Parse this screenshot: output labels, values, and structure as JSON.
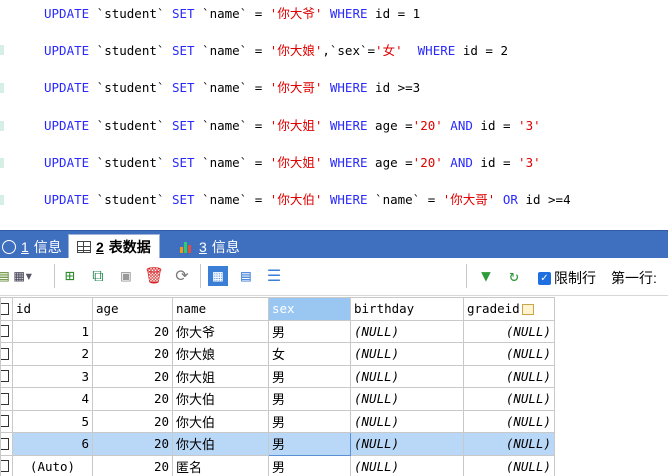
{
  "editor": {
    "lines": [
      [
        [
          "kw",
          "UPDATE"
        ],
        [
          "id",
          " `student` "
        ],
        [
          "kw",
          "SET"
        ],
        [
          "id",
          " `name` = "
        ],
        [
          "str",
          "'你大爷'"
        ],
        [
          "kw",
          " WHERE"
        ],
        [
          "id",
          " id = 1"
        ]
      ],
      [
        [
          "kw",
          "UPDATE"
        ],
        [
          "id",
          " `student` "
        ],
        [
          "kw",
          "SET"
        ],
        [
          "id",
          " `name` = "
        ],
        [
          "str",
          "'你大娘'"
        ],
        [
          "id",
          ",`sex`="
        ],
        [
          "str",
          "'女'"
        ],
        [
          "kw",
          "  WHERE"
        ],
        [
          "id",
          " id = 2"
        ]
      ],
      [
        [
          "kw",
          "UPDATE"
        ],
        [
          "id",
          " `student` "
        ],
        [
          "kw",
          "SET"
        ],
        [
          "id",
          " `name` = "
        ],
        [
          "str",
          "'你大哥'"
        ],
        [
          "kw",
          " WHERE"
        ],
        [
          "id",
          " id >=3"
        ]
      ],
      [
        [
          "kw",
          "UPDATE"
        ],
        [
          "id",
          " `student` "
        ],
        [
          "kw",
          "SET"
        ],
        [
          "id",
          " `name` = "
        ],
        [
          "str",
          "'你大姐'"
        ],
        [
          "kw",
          " WHERE"
        ],
        [
          "id",
          " age ="
        ],
        [
          "str",
          "'20'"
        ],
        [
          "kw",
          " AND"
        ],
        [
          "id",
          " id = "
        ],
        [
          "str",
          "'3'"
        ]
      ],
      [
        [
          "kw",
          "UPDATE"
        ],
        [
          "id",
          " `student` "
        ],
        [
          "kw",
          "SET"
        ],
        [
          "id",
          " `name` = "
        ],
        [
          "str",
          "'你大姐'"
        ],
        [
          "kw",
          " WHERE"
        ],
        [
          "id",
          " age ="
        ],
        [
          "str",
          "'20'"
        ],
        [
          "kw",
          " AND"
        ],
        [
          "id",
          " id = "
        ],
        [
          "str",
          "'3'"
        ]
      ],
      [
        [
          "kw",
          "UPDATE"
        ],
        [
          "id",
          " `student` "
        ],
        [
          "kw",
          "SET"
        ],
        [
          "id",
          " `name` = "
        ],
        [
          "str",
          "'你大伯'"
        ],
        [
          "kw",
          " WHERE"
        ],
        [
          "id",
          " `name` = "
        ],
        [
          "str",
          "'你大哥'"
        ],
        [
          "kw",
          " OR"
        ],
        [
          "id",
          " id >=4"
        ]
      ]
    ]
  },
  "tabs": [
    {
      "num": "1",
      "label": "信息",
      "active": false
    },
    {
      "num": "2",
      "label": "表数据",
      "active": true
    },
    {
      "num": "3",
      "label": "信息",
      "active": false
    }
  ],
  "toolbar": {
    "limit_label": "限制行",
    "first_row_label": "第一行:"
  },
  "grid": {
    "columns": [
      "id",
      "age",
      "name",
      "sex",
      "birthday",
      "gradeid"
    ],
    "rows": [
      [
        "1",
        "20",
        "你大爷",
        "男",
        "(NULL)",
        "(NULL)"
      ],
      [
        "2",
        "20",
        "你大娘",
        "女",
        "(NULL)",
        "(NULL)"
      ],
      [
        "3",
        "20",
        "你大姐",
        "男",
        "(NULL)",
        "(NULL)"
      ],
      [
        "4",
        "20",
        "你大伯",
        "男",
        "(NULL)",
        "(NULL)"
      ],
      [
        "5",
        "20",
        "你大伯",
        "男",
        "(NULL)",
        "(NULL)"
      ],
      [
        "6",
        "20",
        "你大伯",
        "男",
        "(NULL)",
        "(NULL)"
      ],
      [
        "(Auto)",
        "20",
        "匿名",
        "男",
        "(NULL)",
        "(NULL)"
      ]
    ],
    "selected_row": 5,
    "selected_column": "sex"
  },
  "colors": {
    "keyword": "#2a2aff",
    "string": "#e00000",
    "tab_bar": "#3f6fbf",
    "selected_row": "#b9d8f7",
    "selected_header": "#99c7f2"
  }
}
